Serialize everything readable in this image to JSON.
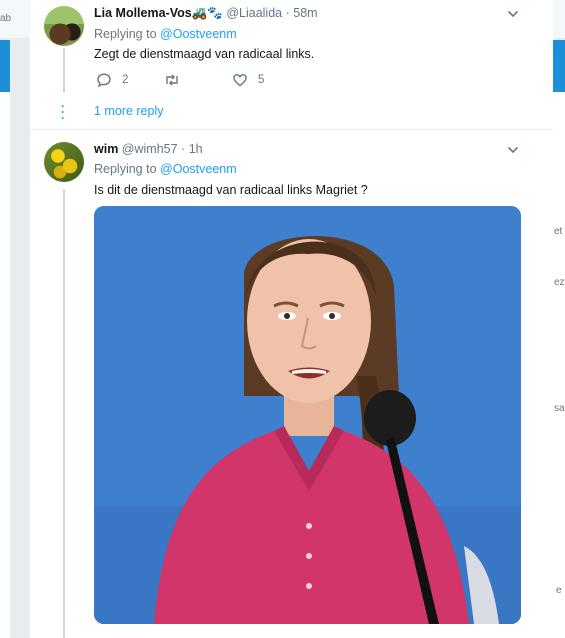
{
  "tweets": [
    {
      "name": "Lia Mollema-Vos🚜🐾",
      "handle": "@Liaalida",
      "separator": "·",
      "time": "58m",
      "replying_label": "Replying to",
      "replying_to": "@Oostveenm",
      "text": "Zegt de dienstmaagd van radicaal links.",
      "reply_count": "2",
      "retweet_count": "",
      "like_count": "5",
      "more_replies": "1 more reply"
    },
    {
      "name": "wim",
      "handle": "@wimh57",
      "separator": "·",
      "time": "1h",
      "replying_label": "Replying to",
      "replying_to": "@Oostveenm",
      "text": "Is dit de dienstmaagd van radicaal links Magriet ?"
    }
  ],
  "background_fragments": {
    "top_left": "ab",
    "right_1": "et",
    "right_2": "ez",
    "right_3": "sa",
    "right_4": "e"
  },
  "colors": {
    "link": "#1da1f2",
    "muted": "#657786",
    "divider": "#e6ecf0",
    "photo_background": "#3e7fcd",
    "shirt": "#d2356a"
  },
  "icons": [
    "chevron-down-icon",
    "reply-icon",
    "retweet-icon",
    "like-icon"
  ]
}
